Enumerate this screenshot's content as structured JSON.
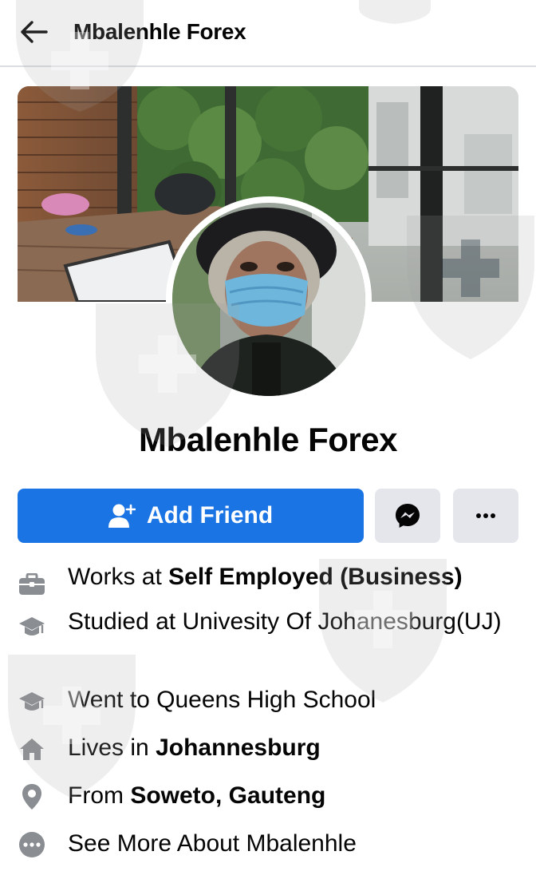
{
  "header": {
    "title": "Mbalenhle Forex"
  },
  "profile": {
    "name": "Mbalenhle Forex",
    "add_friend_label": "Add Friend"
  },
  "about": [
    {
      "icon": "briefcase-icon",
      "prefix": "Works at ",
      "bold": "Self Employed (Business)"
    },
    {
      "icon": "graduation-cap-icon",
      "prefix": "Studied at Univesity Of Johanesburg(UJ)",
      "bold": ""
    },
    {
      "icon": "graduation-cap-icon",
      "prefix": "Went to Queens High School",
      "bold": ""
    },
    {
      "icon": "home-icon",
      "prefix": "Lives in ",
      "bold": "Johannesburg"
    },
    {
      "icon": "location-pin-icon",
      "prefix": "From ",
      "bold": "Soweto, Gauteng"
    },
    {
      "icon": "more-dots-icon",
      "prefix": "See More About Mbalenhle",
      "bold": ""
    }
  ],
  "colors": {
    "accent": "#1b74e4",
    "secondary_button": "#e4e6eb",
    "icon_gray": "#8a8d91"
  }
}
